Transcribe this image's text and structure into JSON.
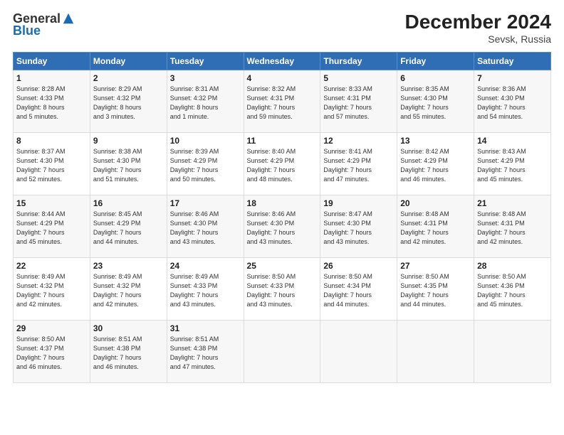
{
  "header": {
    "logo_general": "General",
    "logo_blue": "Blue",
    "month_title": "December 2024",
    "location": "Sevsk, Russia"
  },
  "days_of_week": [
    "Sunday",
    "Monday",
    "Tuesday",
    "Wednesday",
    "Thursday",
    "Friday",
    "Saturday"
  ],
  "weeks": [
    [
      {
        "day": "1",
        "lines": [
          "Sunrise: 8:28 AM",
          "Sunset: 4:33 PM",
          "Daylight: 8 hours",
          "and 5 minutes."
        ]
      },
      {
        "day": "2",
        "lines": [
          "Sunrise: 8:29 AM",
          "Sunset: 4:32 PM",
          "Daylight: 8 hours",
          "and 3 minutes."
        ]
      },
      {
        "day": "3",
        "lines": [
          "Sunrise: 8:31 AM",
          "Sunset: 4:32 PM",
          "Daylight: 8 hours",
          "and 1 minute."
        ]
      },
      {
        "day": "4",
        "lines": [
          "Sunrise: 8:32 AM",
          "Sunset: 4:31 PM",
          "Daylight: 7 hours",
          "and 59 minutes."
        ]
      },
      {
        "day": "5",
        "lines": [
          "Sunrise: 8:33 AM",
          "Sunset: 4:31 PM",
          "Daylight: 7 hours",
          "and 57 minutes."
        ]
      },
      {
        "day": "6",
        "lines": [
          "Sunrise: 8:35 AM",
          "Sunset: 4:30 PM",
          "Daylight: 7 hours",
          "and 55 minutes."
        ]
      },
      {
        "day": "7",
        "lines": [
          "Sunrise: 8:36 AM",
          "Sunset: 4:30 PM",
          "Daylight: 7 hours",
          "and 54 minutes."
        ]
      }
    ],
    [
      {
        "day": "8",
        "lines": [
          "Sunrise: 8:37 AM",
          "Sunset: 4:30 PM",
          "Daylight: 7 hours",
          "and 52 minutes."
        ]
      },
      {
        "day": "9",
        "lines": [
          "Sunrise: 8:38 AM",
          "Sunset: 4:30 PM",
          "Daylight: 7 hours",
          "and 51 minutes."
        ]
      },
      {
        "day": "10",
        "lines": [
          "Sunrise: 8:39 AM",
          "Sunset: 4:29 PM",
          "Daylight: 7 hours",
          "and 50 minutes."
        ]
      },
      {
        "day": "11",
        "lines": [
          "Sunrise: 8:40 AM",
          "Sunset: 4:29 PM",
          "Daylight: 7 hours",
          "and 48 minutes."
        ]
      },
      {
        "day": "12",
        "lines": [
          "Sunrise: 8:41 AM",
          "Sunset: 4:29 PM",
          "Daylight: 7 hours",
          "and 47 minutes."
        ]
      },
      {
        "day": "13",
        "lines": [
          "Sunrise: 8:42 AM",
          "Sunset: 4:29 PM",
          "Daylight: 7 hours",
          "and 46 minutes."
        ]
      },
      {
        "day": "14",
        "lines": [
          "Sunrise: 8:43 AM",
          "Sunset: 4:29 PM",
          "Daylight: 7 hours",
          "and 45 minutes."
        ]
      }
    ],
    [
      {
        "day": "15",
        "lines": [
          "Sunrise: 8:44 AM",
          "Sunset: 4:29 PM",
          "Daylight: 7 hours",
          "and 45 minutes."
        ]
      },
      {
        "day": "16",
        "lines": [
          "Sunrise: 8:45 AM",
          "Sunset: 4:29 PM",
          "Daylight: 7 hours",
          "and 44 minutes."
        ]
      },
      {
        "day": "17",
        "lines": [
          "Sunrise: 8:46 AM",
          "Sunset: 4:30 PM",
          "Daylight: 7 hours",
          "and 43 minutes."
        ]
      },
      {
        "day": "18",
        "lines": [
          "Sunrise: 8:46 AM",
          "Sunset: 4:30 PM",
          "Daylight: 7 hours",
          "and 43 minutes."
        ]
      },
      {
        "day": "19",
        "lines": [
          "Sunrise: 8:47 AM",
          "Sunset: 4:30 PM",
          "Daylight: 7 hours",
          "and 43 minutes."
        ]
      },
      {
        "day": "20",
        "lines": [
          "Sunrise: 8:48 AM",
          "Sunset: 4:31 PM",
          "Daylight: 7 hours",
          "and 42 minutes."
        ]
      },
      {
        "day": "21",
        "lines": [
          "Sunrise: 8:48 AM",
          "Sunset: 4:31 PM",
          "Daylight: 7 hours",
          "and 42 minutes."
        ]
      }
    ],
    [
      {
        "day": "22",
        "lines": [
          "Sunrise: 8:49 AM",
          "Sunset: 4:32 PM",
          "Daylight: 7 hours",
          "and 42 minutes."
        ]
      },
      {
        "day": "23",
        "lines": [
          "Sunrise: 8:49 AM",
          "Sunset: 4:32 PM",
          "Daylight: 7 hours",
          "and 42 minutes."
        ]
      },
      {
        "day": "24",
        "lines": [
          "Sunrise: 8:49 AM",
          "Sunset: 4:33 PM",
          "Daylight: 7 hours",
          "and 43 minutes."
        ]
      },
      {
        "day": "25",
        "lines": [
          "Sunrise: 8:50 AM",
          "Sunset: 4:33 PM",
          "Daylight: 7 hours",
          "and 43 minutes."
        ]
      },
      {
        "day": "26",
        "lines": [
          "Sunrise: 8:50 AM",
          "Sunset: 4:34 PM",
          "Daylight: 7 hours",
          "and 44 minutes."
        ]
      },
      {
        "day": "27",
        "lines": [
          "Sunrise: 8:50 AM",
          "Sunset: 4:35 PM",
          "Daylight: 7 hours",
          "and 44 minutes."
        ]
      },
      {
        "day": "28",
        "lines": [
          "Sunrise: 8:50 AM",
          "Sunset: 4:36 PM",
          "Daylight: 7 hours",
          "and 45 minutes."
        ]
      }
    ],
    [
      {
        "day": "29",
        "lines": [
          "Sunrise: 8:50 AM",
          "Sunset: 4:37 PM",
          "Daylight: 7 hours",
          "and 46 minutes."
        ]
      },
      {
        "day": "30",
        "lines": [
          "Sunrise: 8:51 AM",
          "Sunset: 4:38 PM",
          "Daylight: 7 hours",
          "and 46 minutes."
        ]
      },
      {
        "day": "31",
        "lines": [
          "Sunrise: 8:51 AM",
          "Sunset: 4:38 PM",
          "Daylight: 7 hours",
          "and 47 minutes."
        ]
      },
      null,
      null,
      null,
      null
    ]
  ]
}
